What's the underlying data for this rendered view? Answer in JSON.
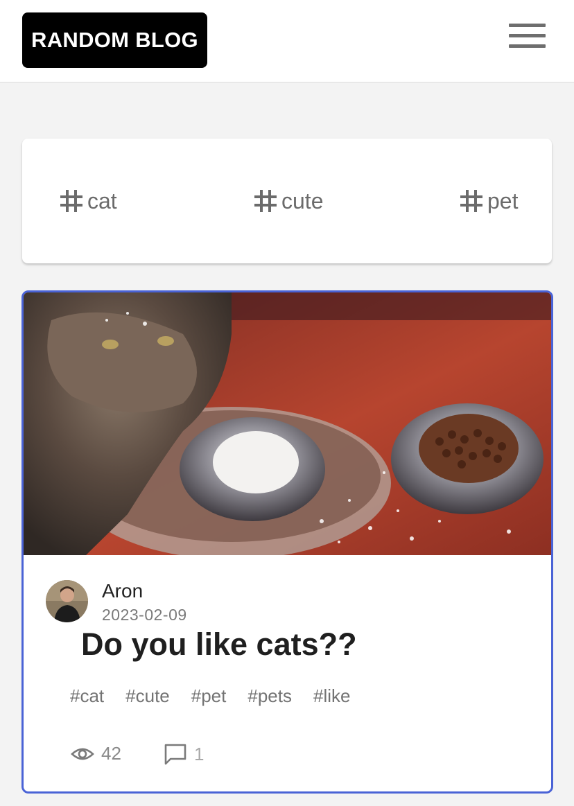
{
  "header": {
    "logo_text": "RANDOM BLOG",
    "menu_icon": "hamburger-menu-icon"
  },
  "tag_bar": {
    "tags": [
      {
        "label": "cat",
        "icon": "hash-icon"
      },
      {
        "label": "cute",
        "icon": "hash-icon"
      },
      {
        "label": "pet",
        "icon": "hash-icon"
      }
    ]
  },
  "post": {
    "author": "Aron",
    "date": "2023-02-09",
    "title": "Do you like cats??",
    "tags": [
      "#cat",
      "#cute",
      "#pet",
      "#pets",
      "#like"
    ],
    "views": "42",
    "comments": "1",
    "views_icon": "eye-icon",
    "comments_icon": "comment-icon",
    "accent_color": "#4a63d6"
  }
}
